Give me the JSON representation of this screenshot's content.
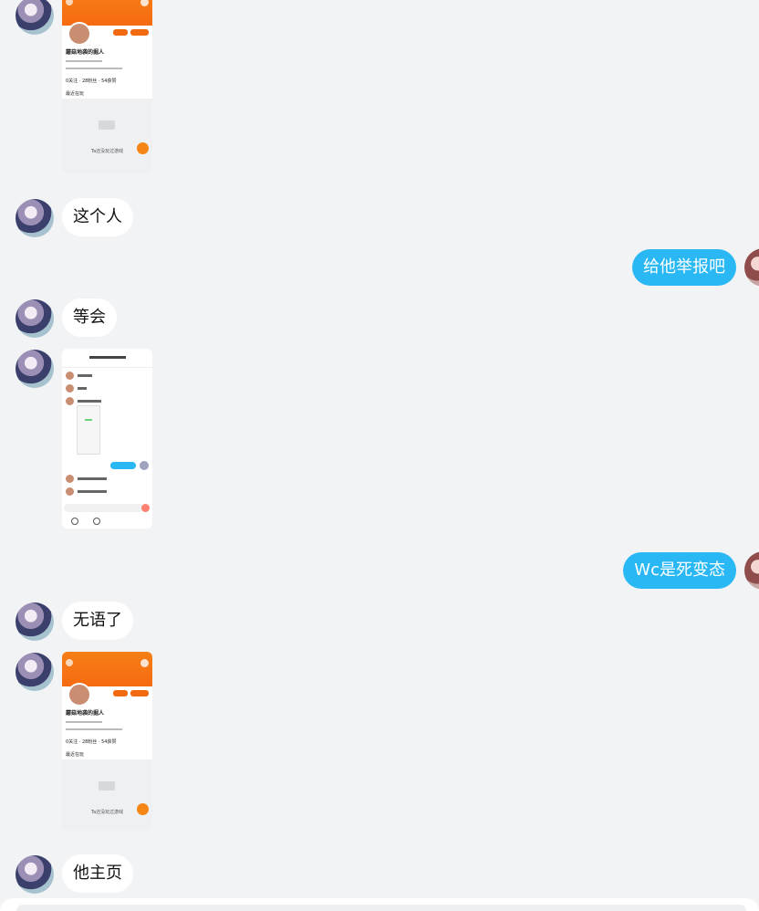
{
  "messages": [
    {
      "id": "m1",
      "side": "left",
      "type": "image",
      "image": "profile-screenshot"
    },
    {
      "id": "m2",
      "side": "left",
      "type": "text",
      "text": "这个人"
    },
    {
      "id": "m3",
      "side": "right",
      "type": "text",
      "text": "给他举报吧"
    },
    {
      "id": "m4",
      "side": "left",
      "type": "text",
      "text": "等会"
    },
    {
      "id": "m5",
      "side": "left",
      "type": "image",
      "image": "chat-screenshot"
    },
    {
      "id": "m6",
      "side": "right",
      "type": "text",
      "text": "Wc是死变态"
    },
    {
      "id": "m7",
      "side": "left",
      "type": "text",
      "text": "无语了"
    },
    {
      "id": "m8",
      "side": "left",
      "type": "image",
      "image": "profile-screenshot"
    },
    {
      "id": "m9",
      "side": "left",
      "type": "text",
      "text": "他主页"
    }
  ],
  "profile_screenshot": {
    "name": "蘑菇地袭的掘人",
    "stats": "0关注 · 28粉丝 · 54获赞",
    "recent_label": "最近在玩",
    "empty_games": "Ta还没玩过游戏"
  },
  "colors": {
    "bubble_right": "#2ab8f5",
    "bubble_left": "#ffffff",
    "background": "#f2f3f5",
    "profile_header": "#f57f15"
  }
}
